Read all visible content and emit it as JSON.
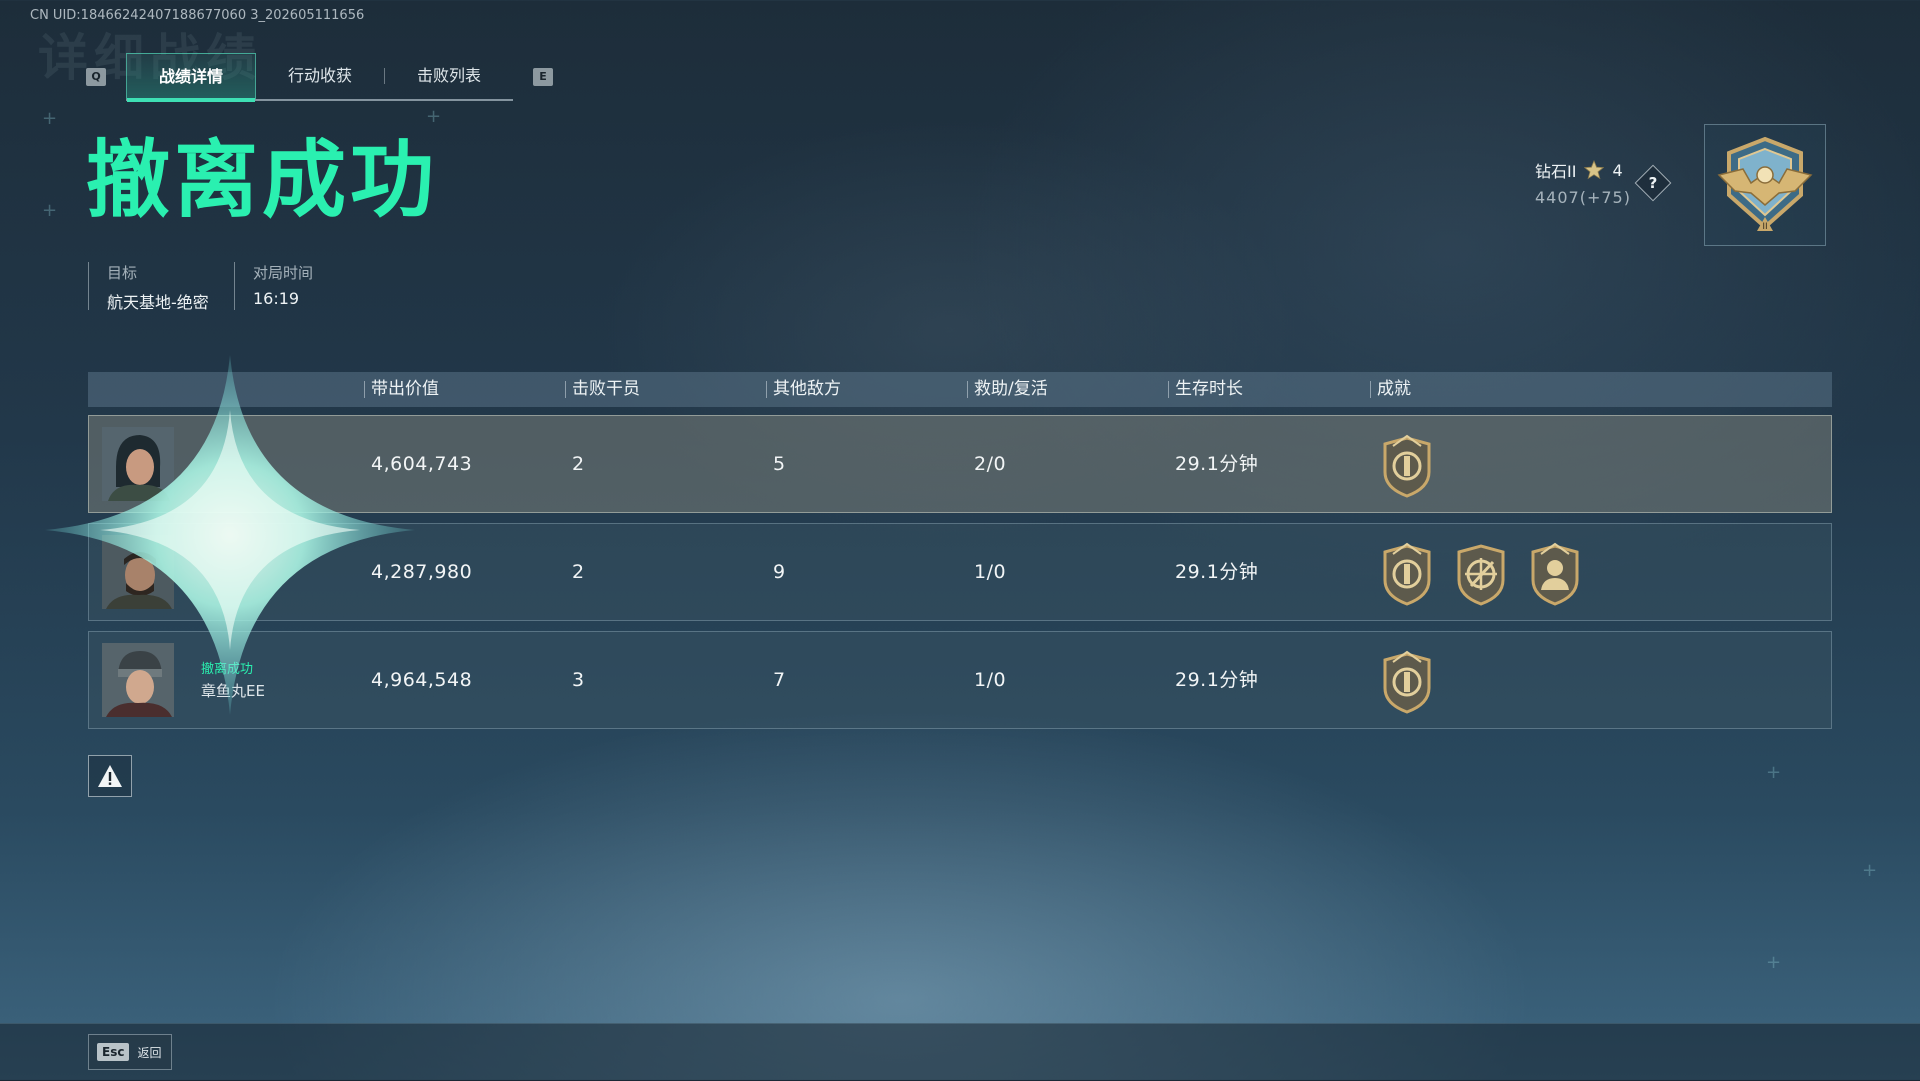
{
  "uid_text": "CN UID:18466242407188677060 3_202605111656",
  "bg_title": "详细战绩",
  "tabs": {
    "left_key": "Q",
    "right_key": "E",
    "items": [
      "战绩详情",
      "行动收获",
      "击败列表"
    ],
    "active_index": 0
  },
  "result": {
    "title": "撤离成功",
    "color": "#2af0b0"
  },
  "info": {
    "target_label": "目标",
    "target_value": "航天基地-绝密",
    "time_label": "对局时间",
    "time_value": "16:19"
  },
  "rank": {
    "tier": "钻石II",
    "stars": "4",
    "score": "4407(+75)",
    "help": "?"
  },
  "table": {
    "headers": [
      "带出价值",
      "击败干员",
      "其他敌方",
      "救助/复活",
      "生存时长",
      "成就"
    ],
    "rows": [
      {
        "status": "",
        "name": "",
        "value": "4,604,743",
        "kills": "2",
        "other": "5",
        "assist": "2/0",
        "survival": "29.1分钟",
        "medals": [
          "shield-medal-icon"
        ]
      },
      {
        "status": "",
        "name": "",
        "value": "4,287,980",
        "kills": "2",
        "other": "9",
        "assist": "1/0",
        "survival": "29.1分钟",
        "medals": [
          "shield-medal-icon",
          "crosshair-medal-icon",
          "operator-medal-icon"
        ]
      },
      {
        "status": "撤离成功",
        "name": "章鱼丸EE",
        "value": "4,964,548",
        "kills": "3",
        "other": "7",
        "assist": "1/0",
        "survival": "29.1分钟",
        "medals": [
          "shield-medal-icon"
        ]
      }
    ]
  },
  "footer": {
    "esc_key": "Esc",
    "back_label": "返回"
  },
  "colors": {
    "accent": "#2af0b0",
    "gold": "#c9a86a"
  }
}
